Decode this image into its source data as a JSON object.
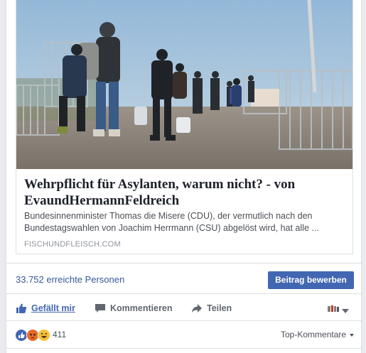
{
  "link_preview": {
    "headline": "Wehrpflicht für Asylanten, warum nicht? - von EvaundHermannFeldreich",
    "description": "Bundesinnenminister Thomas die Misere (CDU), der vermutlich nach den Bundestagswahlen von Joachim Herrmann (CSU) abgelöst wird, hat alle ...",
    "domain": "FISCHUNDFLEISCH.COM"
  },
  "insights": {
    "reach_text": "33.752 erreichte Personen",
    "promote_label": "Beitrag bewerben"
  },
  "actions": {
    "like_label": "Gefällt mir",
    "comment_label": "Kommentieren",
    "share_label": "Teilen"
  },
  "reactions": {
    "types": [
      "like-icon",
      "angry-icon",
      "haha-icon"
    ],
    "count": "411",
    "sort_label": "Top-Kommentare"
  },
  "colors": {
    "link_blue": "#365899",
    "button_blue": "#4267b2",
    "like_blue": "#4267b2",
    "page_bg": "#e9ebee"
  }
}
